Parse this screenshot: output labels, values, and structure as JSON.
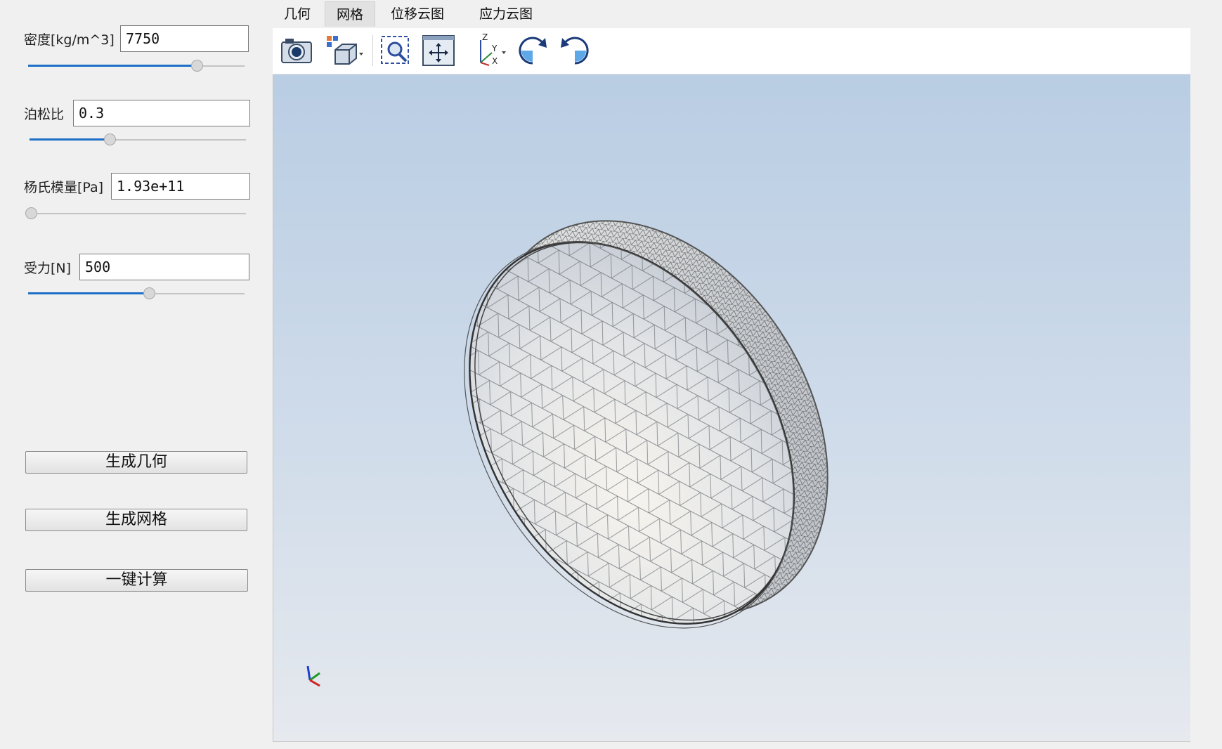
{
  "params": {
    "density": {
      "label": "密度[kg/m^3]",
      "value": "7750",
      "slider_fraction": 0.78
    },
    "poisson": {
      "label": "泊松比",
      "value": "0.3",
      "slider_fraction": 0.37
    },
    "youngs": {
      "label": "杨氏模量[Pa]",
      "value": "1.93e+11",
      "slider_fraction": 0.0
    },
    "force": {
      "label": "受力[N]",
      "value": "500",
      "slider_fraction": 0.56
    }
  },
  "buttons": {
    "gen_geometry": "生成几何",
    "gen_mesh": "生成网格",
    "compute": "一键计算"
  },
  "tabs": [
    {
      "label": "几何",
      "active": false
    },
    {
      "label": "网格",
      "active": true
    },
    {
      "label": "位移云图",
      "active": false
    },
    {
      "label": "应力云图",
      "active": false
    }
  ],
  "toolbar": {
    "icons": [
      "camera-icon",
      "view-cube-icon",
      "zoom-box-icon",
      "fit-view-icon",
      "axis-orientation-icon",
      "rotate-cw-icon",
      "rotate-ccw-icon"
    ],
    "axis_labels": {
      "z": "Z",
      "y": "Y",
      "x": "X"
    }
  },
  "viewport": {
    "model": "mesh-dish",
    "background_top": "#b9cde3",
    "background_bottom": "#e6e9ee"
  },
  "colors": {
    "accent": "#1e6fc7"
  }
}
